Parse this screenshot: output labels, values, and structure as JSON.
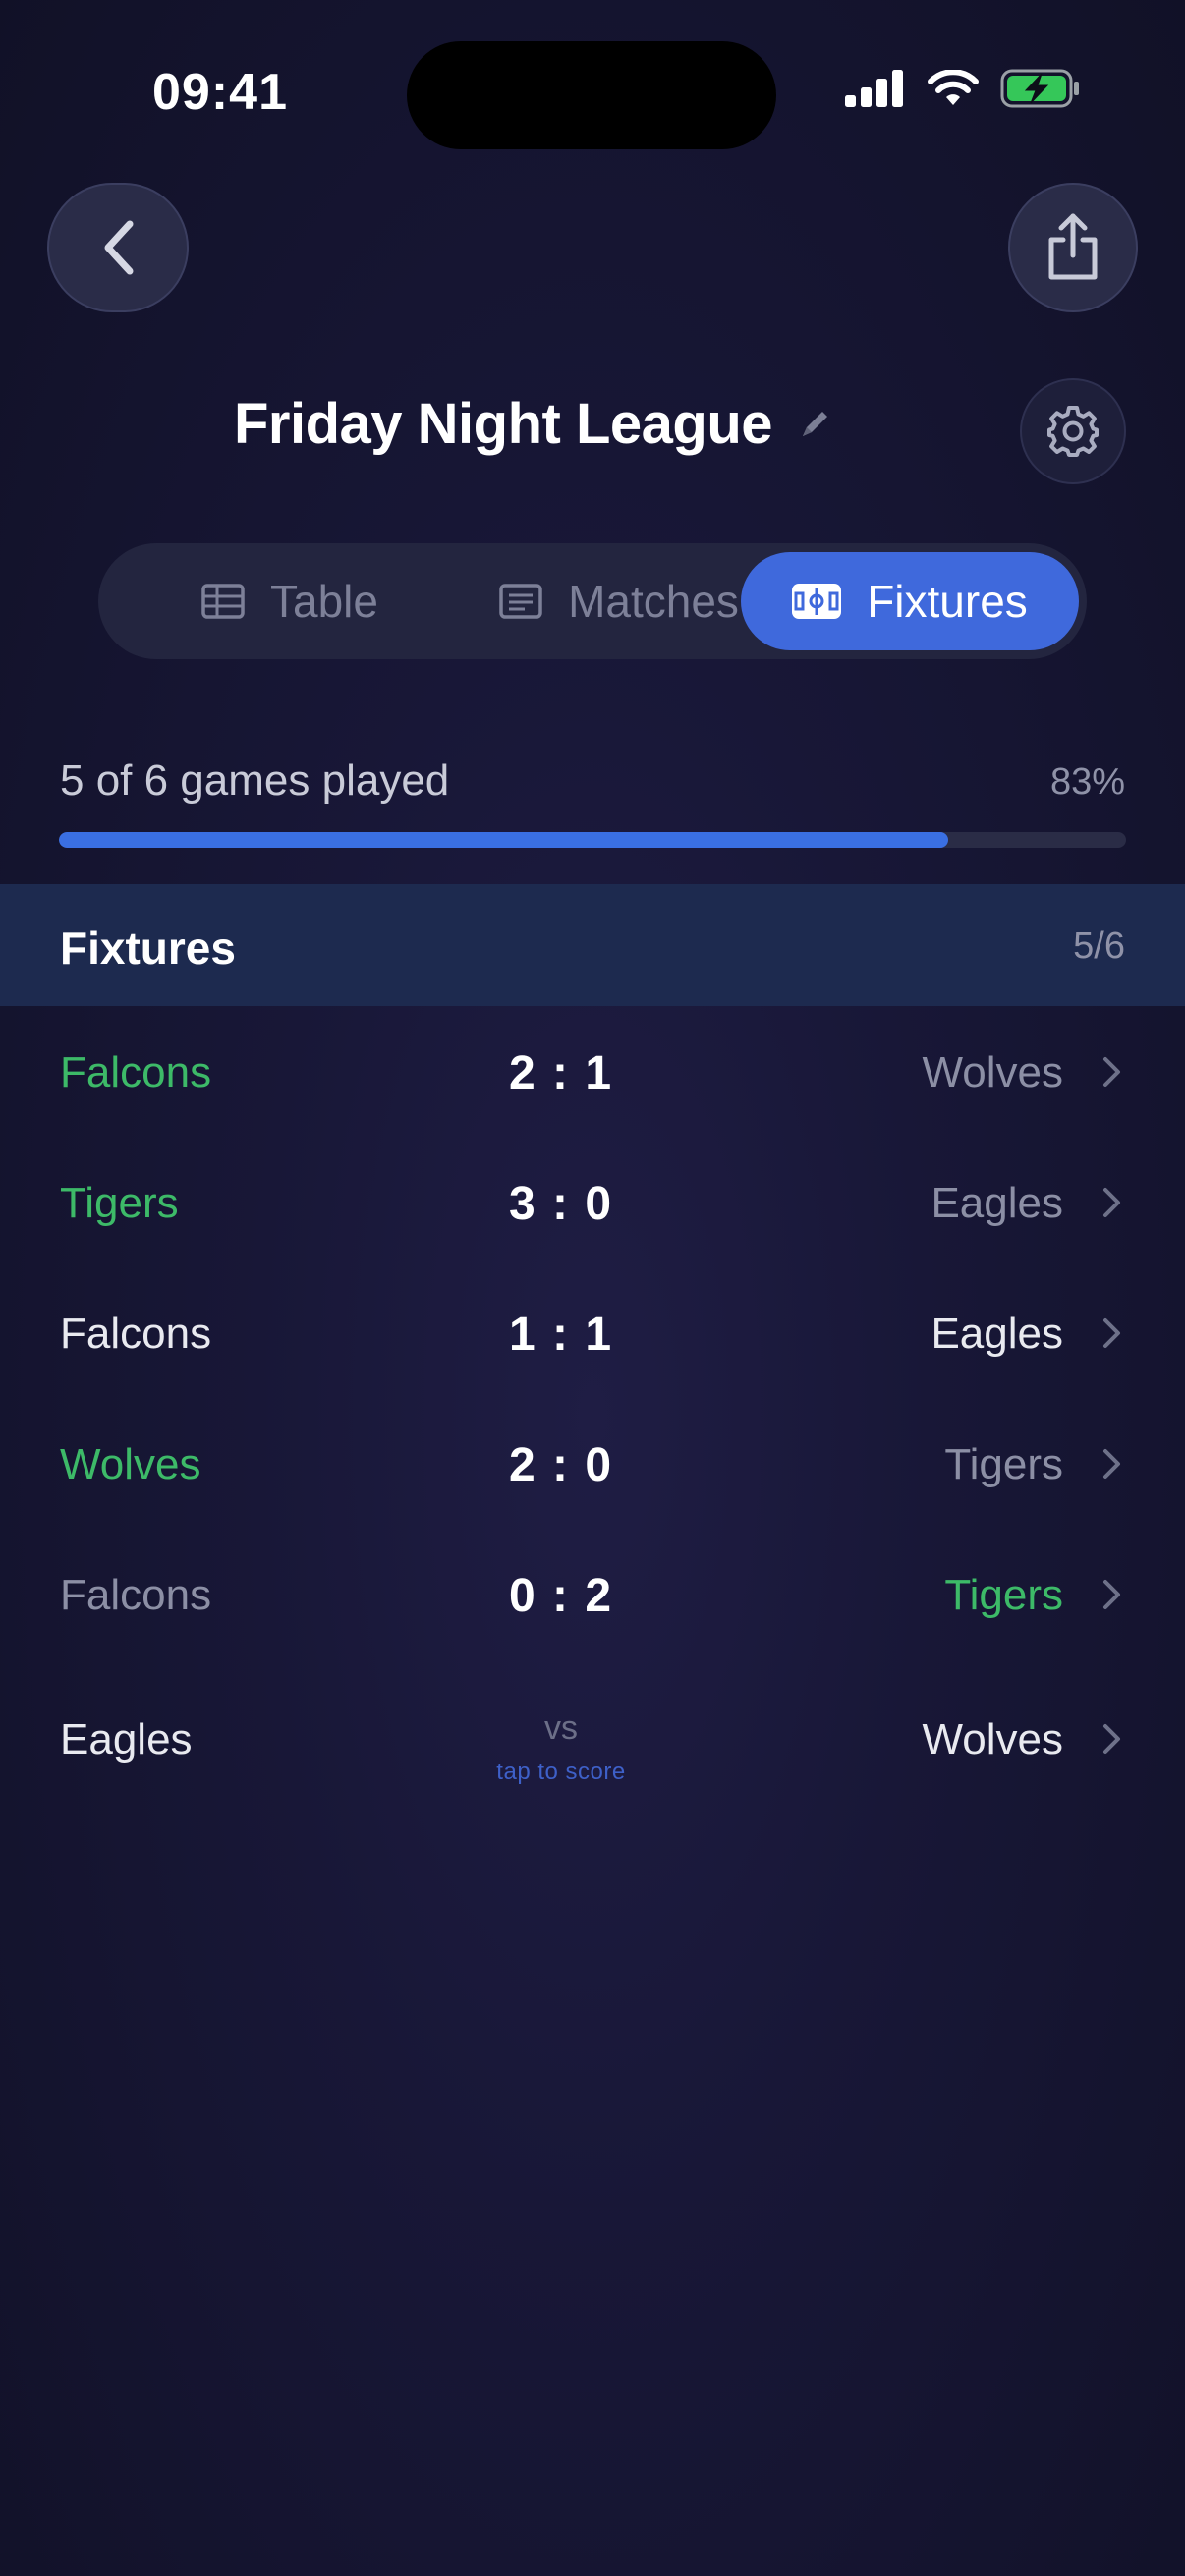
{
  "status_bar": {
    "time": "09:41",
    "icons": [
      "signal-icon",
      "wifi-icon",
      "battery-charging-icon"
    ]
  },
  "header": {
    "back_icon": "chevron-left-icon",
    "share_icon": "share-icon",
    "title": "Friday Night League",
    "edit_icon": "pencil-icon",
    "settings_icon": "gear-icon"
  },
  "tabs": [
    {
      "label": "Table",
      "icon": "table-icon",
      "selected": false
    },
    {
      "label": "Matches",
      "icon": "list-icon",
      "selected": false
    },
    {
      "label": "Fixtures",
      "icon": "pitch-icon",
      "selected": true
    }
  ],
  "progress": {
    "label": "5 of 6 games played",
    "percent_text": "83%",
    "fraction": 0.833
  },
  "fixtures_section": {
    "title": "Fixtures",
    "count": "5/6"
  },
  "fixtures": [
    {
      "home": "Falcons",
      "score": "2 : 1",
      "away": "Wolves",
      "home_state": "win",
      "away_state": "loss"
    },
    {
      "home": "Tigers",
      "score": "3 : 0",
      "away": "Eagles",
      "home_state": "win",
      "away_state": "loss"
    },
    {
      "home": "Falcons",
      "score": "1 : 1",
      "away": "Eagles",
      "home_state": "neutral",
      "away_state": "neutral"
    },
    {
      "home": "Wolves",
      "score": "2 : 0",
      "away": "Tigers",
      "home_state": "win",
      "away_state": "loss"
    },
    {
      "home": "Falcons",
      "score": "0 : 2",
      "away": "Tigers",
      "home_state": "loss",
      "away_state": "win"
    }
  ],
  "pending_fixture": {
    "home": "Eagles",
    "vs": "vs",
    "hint": "tap to score",
    "away": "Wolves"
  },
  "colors": {
    "accent": "#3f69dc",
    "win": "#3dba68",
    "loss": "#8c8fa5",
    "neutral": "#e9eaf0"
  }
}
